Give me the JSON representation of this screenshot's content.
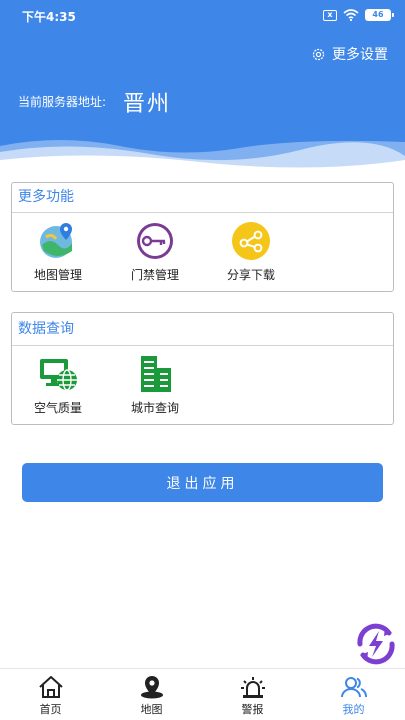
{
  "status_bar": {
    "time": "下午4:35",
    "sim_badge": "x",
    "battery": "46"
  },
  "header": {
    "more_settings": "更多设置",
    "server_label": "当前服务器地址:",
    "server_value": "晋州"
  },
  "more_functions": {
    "title": "更多功能",
    "items": [
      {
        "label": "地图管理",
        "icon": "map-icon"
      },
      {
        "label": "门禁管理",
        "icon": "key-icon"
      },
      {
        "label": "分享下载",
        "icon": "share-icon"
      }
    ]
  },
  "data_query": {
    "title": "数据查询",
    "items": [
      {
        "label": "空气质量",
        "icon": "monitor-globe-icon"
      },
      {
        "label": "城市查询",
        "icon": "city-buildings-icon"
      }
    ]
  },
  "exit_button": "退出应用",
  "tabbar": {
    "active": "我的",
    "tabs": [
      {
        "label": "首页",
        "icon": "home-icon"
      },
      {
        "label": "地图",
        "icon": "map-pin-icon"
      },
      {
        "label": "警报",
        "icon": "alarm-icon"
      },
      {
        "label": "我的",
        "icon": "users-icon"
      }
    ]
  },
  "colors": {
    "accent": "#3e86e8",
    "purple": "#7b3b93",
    "yellow": "#f5c518",
    "green": "#1a9a3a"
  }
}
